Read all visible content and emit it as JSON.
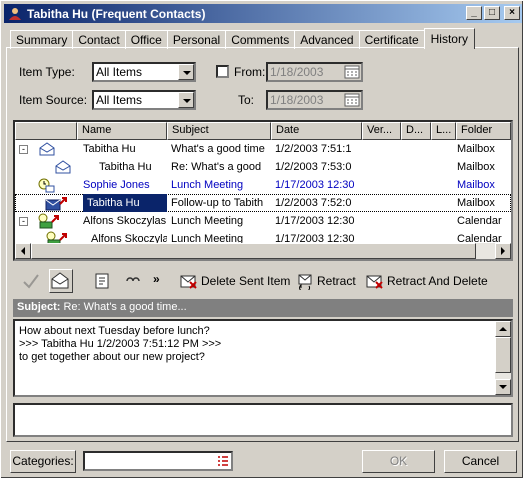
{
  "window": {
    "title": "Tabitha Hu (Frequent Contacts)"
  },
  "tabs": [
    "Summary",
    "Contact",
    "Office",
    "Personal",
    "Comments",
    "Advanced",
    "Certificate",
    "History"
  ],
  "filters": {
    "item_type_label": "Item Type:",
    "item_type_value": "All Items",
    "item_source_label": "Item Source:",
    "item_source_value": "All Items",
    "from_label": "From:",
    "from_value": "1/18/2003",
    "to_label": "To:",
    "to_value": "1/18/2003"
  },
  "columns": [
    "Name",
    "Subject",
    "Date",
    "Ver...",
    "D...",
    "L...",
    "Folder"
  ],
  "rows": [
    {
      "name": "Tabitha Hu",
      "subject": "What's a good time",
      "date": "1/2/2003 7:51:1",
      "folder": "Mailbox",
      "icon": "envelope-open-icon",
      "expander": "-"
    },
    {
      "name": "Tabitha Hu",
      "subject": "Re: What's a good",
      "date": "1/2/2003 7:53:0",
      "folder": "Mailbox",
      "icon": "envelope-open-icon",
      "expander": ""
    },
    {
      "name": "Sophie Jones",
      "subject": "Lunch Meeting",
      "date": "1/17/2003 12:30",
      "folder": "Mailbox",
      "icon": "meeting-request-icon",
      "expander": ""
    },
    {
      "name": "Tabitha Hu",
      "subject": "Follow-up to Tabith",
      "date": "1/2/2003 7:52:0",
      "folder": "Mailbox",
      "icon": "envelope-sent-icon",
      "expander": ""
    },
    {
      "name": "Alfons Skoczylas",
      "subject": "Lunch Meeting",
      "date": "1/17/2003 12:30",
      "folder": "Calendar",
      "icon": "meeting-icon",
      "expander": "-"
    },
    {
      "name": "Alfons Skoczylas",
      "subject": "Lunch Meeting",
      "date": "1/17/2003 12:30",
      "folder": "Calendar",
      "icon": "meeting-icon",
      "expander": ""
    }
  ],
  "toolbar": {
    "delete_sent": "Delete Sent Item",
    "retract": "Retract",
    "retract_delete": "Retract And Delete",
    "more": "»"
  },
  "preview": {
    "subject_label": "Subject:",
    "subject_value": "Re: What's a good time...",
    "lines": [
      "How about next Tuesday before lunch?",
      "",
      ">>> Tabitha Hu 1/2/2003 7:51:12 PM >>>",
      "to get together about our new project?"
    ]
  },
  "buttons": {
    "categories": "Categories:",
    "ok": "OK",
    "cancel": "Cancel"
  }
}
